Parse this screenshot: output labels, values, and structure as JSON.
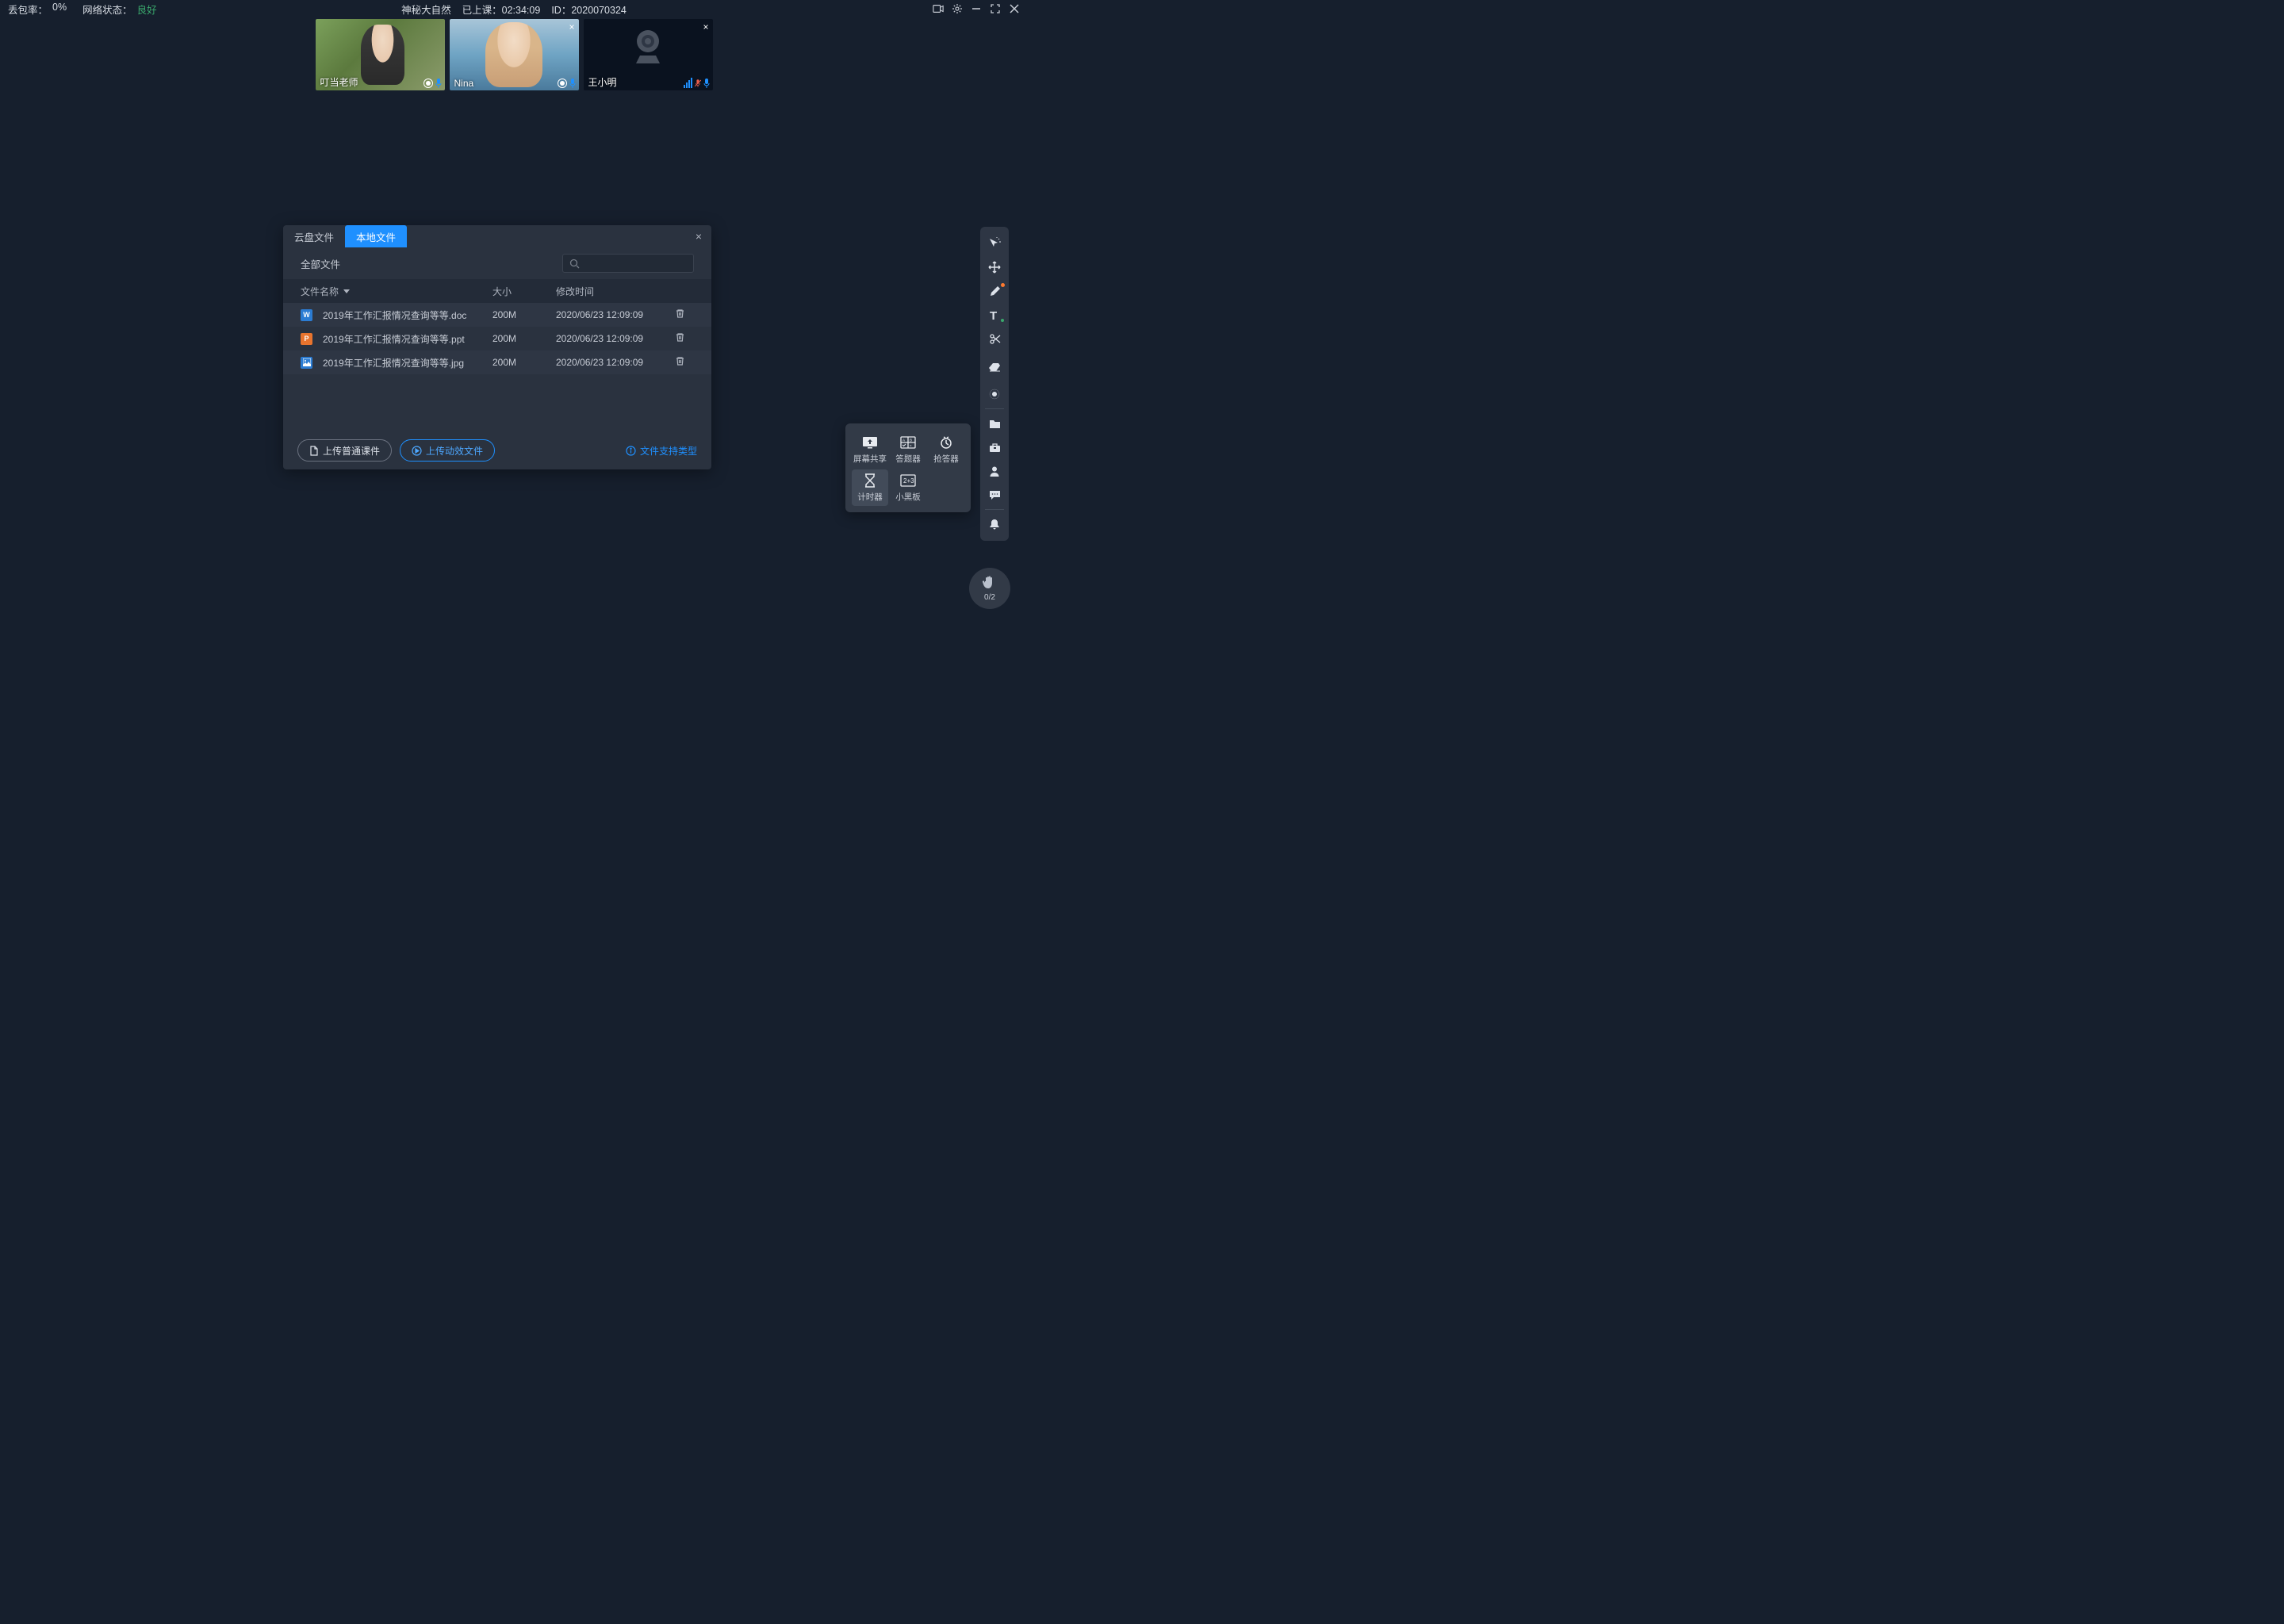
{
  "topbar": {
    "packet_loss_label": "丢包率：",
    "packet_loss_value": "0%",
    "network_label": "网络状态：",
    "network_value": "良好",
    "course_title": "神秘大自然",
    "elapsed_label": "已上课：",
    "elapsed_value": "02:34:09",
    "id_label": "ID：",
    "id_value": "2020070324"
  },
  "participants": [
    {
      "name": "叮当老师",
      "mic": "on",
      "cam": "on",
      "closable": false,
      "avatar": "thumb1"
    },
    {
      "name": "Nina",
      "mic": "on",
      "cam": "on",
      "closable": true,
      "avatar": "thumb2"
    },
    {
      "name": "王小明",
      "mic": "muted",
      "cam": "off",
      "closable": true,
      "avatar": "off"
    }
  ],
  "dialog": {
    "tabs": [
      "云盘文件",
      "本地文件"
    ],
    "active_tab": 1,
    "crumb": "全部文件",
    "columns": {
      "name": "文件名称",
      "size": "大小",
      "time": "修改时间"
    },
    "files": [
      {
        "icon": "W",
        "name": "2019年工作汇报情况查询等等.doc",
        "size": "200M",
        "time": "2020/06/23 12:09:09"
      },
      {
        "icon": "P",
        "name": "2019年工作汇报情况查询等等.ppt",
        "size": "200M",
        "time": "2020/06/23 12:09:09"
      },
      {
        "icon": "I",
        "name": "2019年工作汇报情况查询等等.jpg",
        "size": "200M",
        "time": "2020/06/23 12:09:09"
      }
    ],
    "upload_normal": "上传普通课件",
    "upload_anim": "上传动效文件",
    "support_link": "文件支持类型"
  },
  "popover": {
    "items": [
      {
        "key": "screen-share",
        "label": "屏幕共享"
      },
      {
        "key": "answer",
        "label": "答题器"
      },
      {
        "key": "buzzer",
        "label": "抢答器"
      },
      {
        "key": "timer",
        "label": "计时器",
        "active": true
      },
      {
        "key": "blackboard",
        "label": "小黑板"
      }
    ]
  },
  "sidebar": [
    "laser",
    "move",
    "pen",
    "text",
    "scissors",
    "eraser",
    "spotlight",
    "|",
    "folder",
    "toolbox",
    "person",
    "chat",
    "|",
    "bell"
  ],
  "hand": {
    "count": "0/2"
  }
}
